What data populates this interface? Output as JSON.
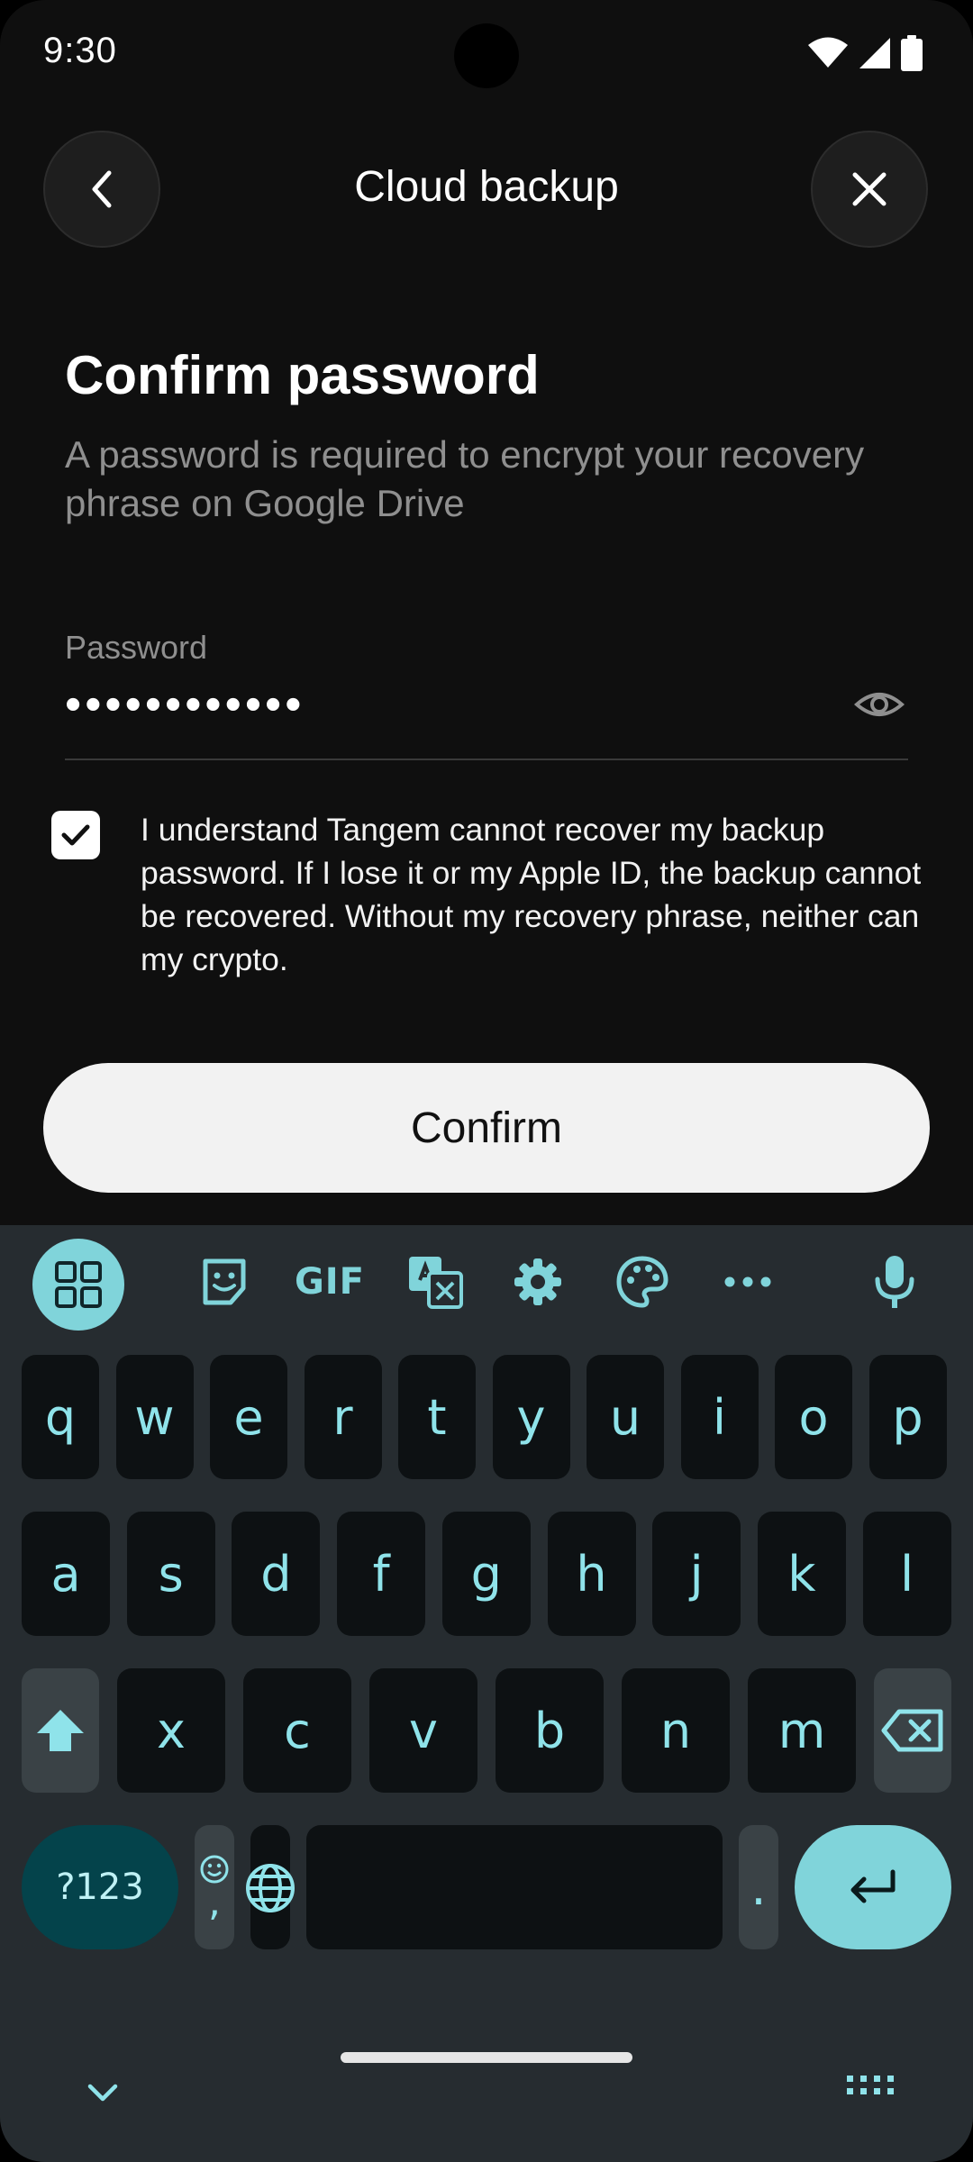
{
  "status_bar": {
    "time": "9:30",
    "icons": [
      "wifi-icon",
      "signal-icon",
      "battery-icon"
    ]
  },
  "header": {
    "title": "Cloud backup",
    "back_icon": "chevron-left-icon",
    "close_icon": "close-icon"
  },
  "content": {
    "title": "Confirm password",
    "subtitle": "A password is required to encrypt your recovery phrase on Google Drive",
    "password_field": {
      "label": "Password",
      "value": "••••••••••••",
      "toggle_icon": "eye-icon"
    },
    "consent": {
      "checked": true,
      "text": "I understand Tangem cannot recover my backup password. If I lose it or my Apple ID, the backup cannot be recovered. Without my recovery phrase, neither can my crypto."
    },
    "confirm_label": "Confirm"
  },
  "keyboard": {
    "toolbar_icons": [
      "apps-grid-icon",
      "sticker-icon",
      "gif-icon",
      "translate-icon",
      "settings-icon",
      "palette-icon",
      "more-icon",
      "mic-icon"
    ],
    "gif_label": "GIF",
    "row1": [
      "q",
      "w",
      "e",
      "r",
      "t",
      "y",
      "u",
      "i",
      "o",
      "p"
    ],
    "row2": [
      "a",
      "s",
      "d",
      "f",
      "g",
      "h",
      "j",
      "k",
      "l"
    ],
    "row3": [
      "x",
      "c",
      "v",
      "b",
      "n",
      "m"
    ],
    "num_key": "?123",
    "comma_key": ",",
    "period_key": ".",
    "accent": "#80d4da"
  }
}
